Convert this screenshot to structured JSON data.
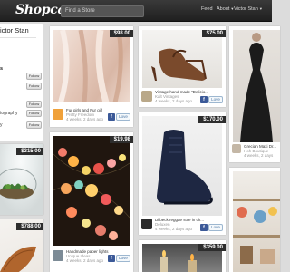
{
  "header": {
    "logo": "Shopcastr",
    "search_placeholder": "Find a Store",
    "nav": {
      "feed": "Feed",
      "about": "About",
      "user": "Victor Stan"
    }
  },
  "sidebar": {
    "user_name": "ictor Stan",
    "heading": "s",
    "rows": [
      {
        "label": "",
        "button": "Follow"
      },
      {
        "label": "",
        "button": "Follow"
      },
      {
        "label": "",
        "button": "Follow"
      },
      {
        "label": "tography",
        "button": "Follow"
      },
      {
        "label": "y",
        "button": "Follow"
      }
    ]
  },
  "cards": {
    "fur": {
      "price": "$98.00",
      "title": "Fur girls and Fur girl",
      "shop": "Pretty Freedom",
      "meta": "4 weeks, 2 days ago",
      "love": "Love"
    },
    "sandals": {
      "price": "$75.00",
      "title": "Vintage hand made \"Delicio...",
      "shop": "Kalt Vintages",
      "meta": "4 weeks, 2 days ago",
      "love": "Love"
    },
    "boot": {
      "price": "$170.00",
      "title": "Dilbeck reggae sole in ch...",
      "shop": "Deluxen",
      "meta": "4 weeks, 2 days ago",
      "love": "Love"
    },
    "lights": {
      "price": "$19.98",
      "title": "Handmade paper lights",
      "shop": "Unique Ideas",
      "meta": "4 weeks, 2 days ago",
      "love": "Love"
    },
    "terrarium": {
      "price": "$315.00"
    },
    "partial_bottom": {
      "price": "$788.00"
    },
    "bottom_right": {
      "price": "$359.00"
    },
    "dress": {
      "title": "Grecian Maxi Dr...",
      "shop": "Hoh Boutique",
      "meta": "4 weeks, 2 days"
    }
  }
}
